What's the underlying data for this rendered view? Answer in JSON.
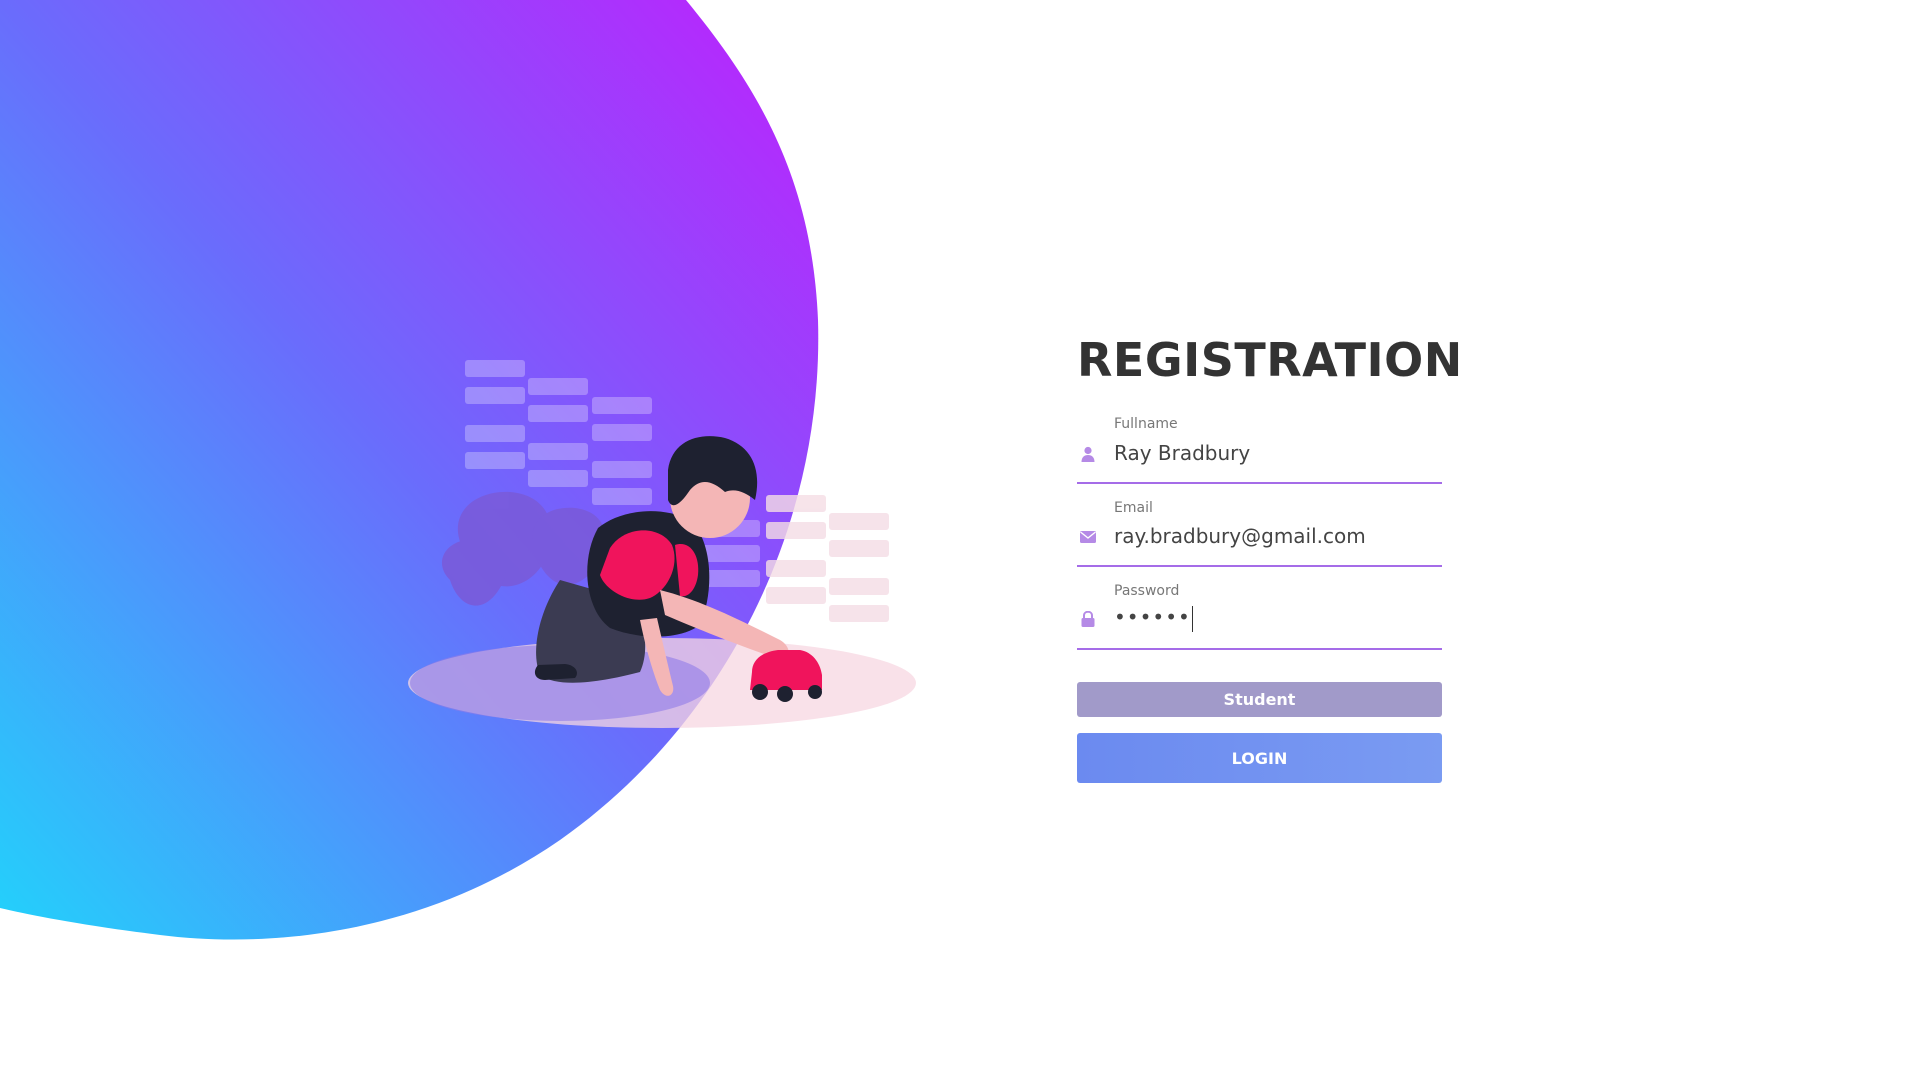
{
  "form": {
    "title": "REGISTRATION",
    "fields": [
      {
        "label": "Fullname",
        "value": "Ray Bradbury",
        "icon": "user-icon"
      },
      {
        "label": "Email",
        "value": "ray.bradbury@gmail.com",
        "icon": "envelope-icon"
      },
      {
        "label": "Password",
        "value": "••••••",
        "icon": "lock-icon"
      }
    ],
    "role_button_label": "Student",
    "login_button_label": "LOGIN"
  },
  "colors": {
    "gradient_start": "#2cc6fb",
    "gradient_end": "#b122fd",
    "accent": "#a56ce8",
    "role_button": "#a19ac9",
    "login_button": "#6b8af0"
  }
}
